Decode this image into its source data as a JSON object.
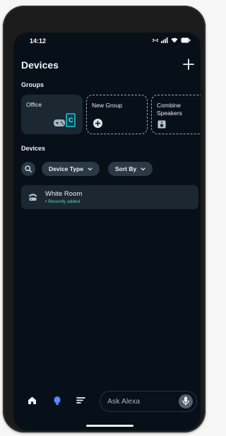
{
  "status_bar": {
    "time": "14:12"
  },
  "header": {
    "title": "Devices",
    "add_icon": "plus-icon"
  },
  "groups": {
    "label": "Groups",
    "cards": [
      {
        "label": "Office",
        "icon": "office-devices-icon"
      },
      {
        "label": "New Group",
        "icon": "plus-circle-icon"
      },
      {
        "label": "Combine Speakers",
        "icon": "speaker-icon"
      }
    ]
  },
  "devices": {
    "label": "Devices",
    "filters": {
      "device_type": "Device Type",
      "sort_by": "Sort By"
    },
    "items": [
      {
        "name": "White Room",
        "status": "• Recently added",
        "status_color": "#5dd39e",
        "icon": "router-icon"
      }
    ]
  },
  "bottom_bar": {
    "nav_icons": [
      "home-icon",
      "alexa-icon",
      "menu-icon"
    ],
    "ask_placeholder": "Ask Alexa",
    "mic_icon": "microphone-icon"
  },
  "colors": {
    "background": "#071018",
    "card": "#1b2731",
    "accent": "#4f8dff"
  }
}
